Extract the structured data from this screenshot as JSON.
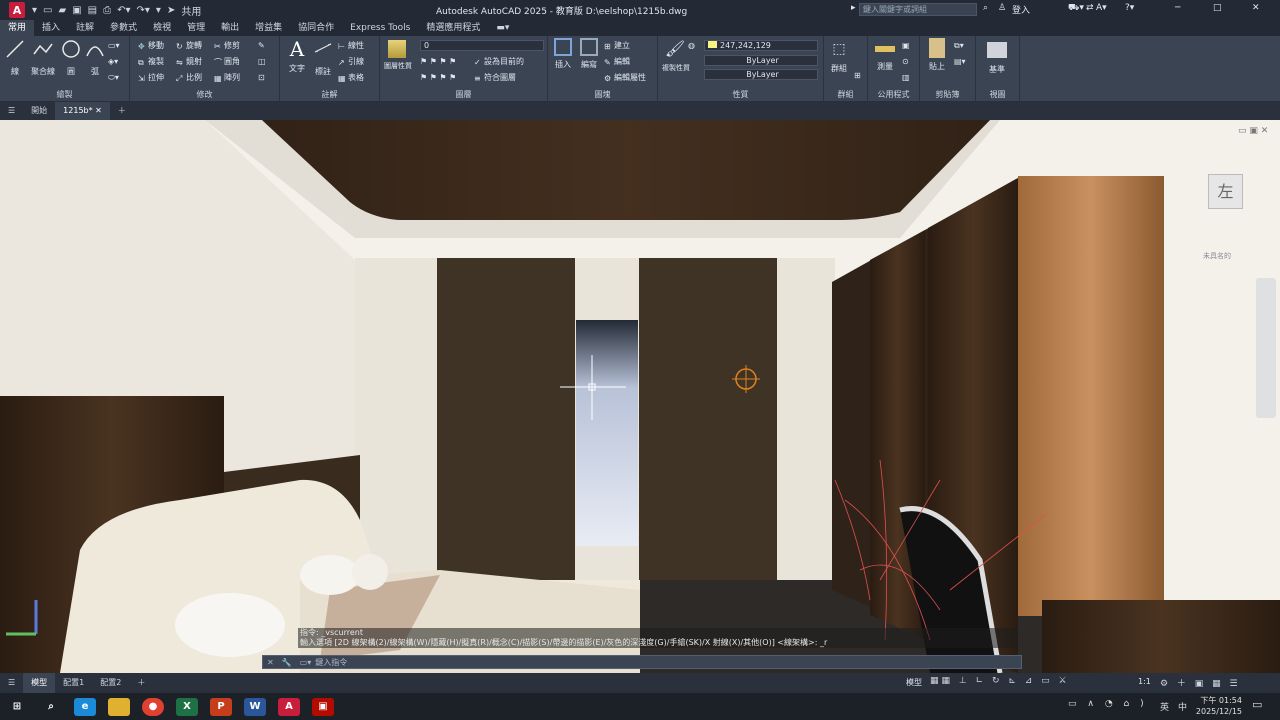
{
  "titlebar": {
    "logo": "A",
    "share": "共用",
    "title": "Autodesk AutoCAD 2025 - 教育版    D:\\eelshop\\1215b.dwg",
    "search_placeholder": "鍵入關鍵字或詞組",
    "signin": "登入"
  },
  "ribbon_tabs": [
    "常用",
    "插入",
    "註解",
    "參數式",
    "檢視",
    "管理",
    "輸出",
    "增益集",
    "協同合作",
    "Express Tools",
    "精選應用程式"
  ],
  "ribbon": {
    "draw": {
      "title": "繪製",
      "line": "線",
      "polyline": "聚合線",
      "circle": "圓",
      "arc": "弧"
    },
    "modify": {
      "title": "修改",
      "move": "移動",
      "rotate": "旋轉",
      "trim": "修剪",
      "copy": "複製",
      "mirror": "鏡射",
      "fillet": "圓角",
      "stretch": "拉伸",
      "scale": "比例",
      "array": "陣列"
    },
    "annotation": {
      "title": "註解",
      "text": "文字",
      "dim": "標註",
      "leader": "線性",
      "multileader": "引線",
      "table": "表格"
    },
    "layers": {
      "title": "圖層",
      "props": "圖層性質",
      "current": "0",
      "set_current": "設為目前的",
      "match": "符合圖層"
    },
    "block": {
      "title": "圖塊",
      "insert": "插入",
      "edit": "編寫",
      "create": "建立",
      "edit2": "編輯",
      "edit_attr": "編輯屬性"
    },
    "properties": {
      "title": "性質",
      "match": "複製性質",
      "color": "247,242,129",
      "linetype": "ByLayer",
      "lineweight": "ByLayer"
    },
    "groups": {
      "title": "群組",
      "group": "群組"
    },
    "utilities": {
      "title": "公用程式",
      "measure": "測量"
    },
    "clipboard": {
      "title": "剪貼簿",
      "paste": "貼上"
    },
    "view": {
      "title": "視圖",
      "base": "基準"
    }
  },
  "doc_tabs": {
    "start": "開始",
    "file": "1215b*"
  },
  "viewcube": {
    "face": "左",
    "wcs": "未具名的"
  },
  "command": {
    "line1": "指令: _vscurrent",
    "line2": "輸入選項 [2D 線架構(2)/線架構(W)/隱藏(H)/擬真(R)/概念(C)/描影(S)/帶邊的描影(E)/灰色的深淺度(G)/手繪(SK)/X 射線(X)/其他(O)] <線架構>: _r",
    "placeholder": "鍵入指令"
  },
  "status_tabs": [
    "模型",
    "配置1",
    "配置2"
  ],
  "status_right": {
    "model": "模型",
    "scale": "1:1"
  },
  "taskbar": {
    "time": "下午 01:54",
    "date": "2025/12/15",
    "ime": "英",
    "ime2": "中"
  }
}
